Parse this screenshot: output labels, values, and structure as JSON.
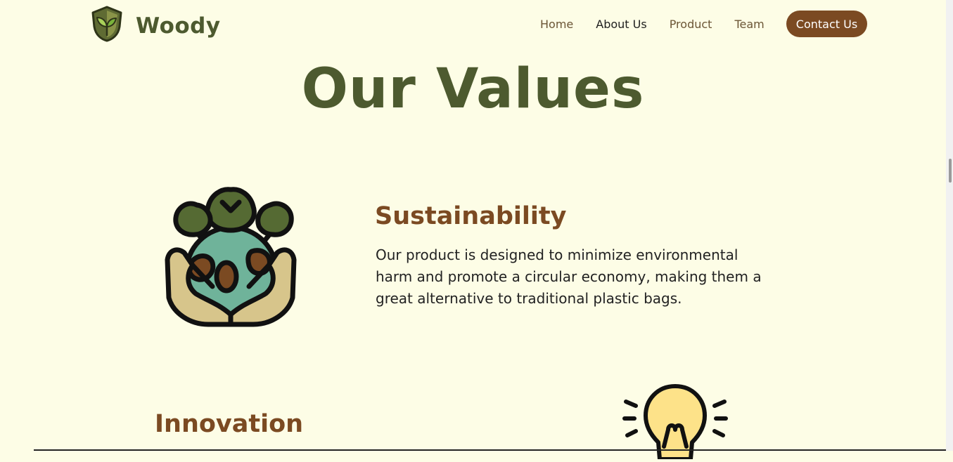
{
  "brand": {
    "name": "Woody"
  },
  "nav": {
    "items": [
      {
        "label": "Home"
      },
      {
        "label": "About Us"
      },
      {
        "label": "Product"
      },
      {
        "label": "Team"
      }
    ],
    "active": "About Us",
    "cta": "Contact Us"
  },
  "page": {
    "title": "Our Values"
  },
  "values": [
    {
      "title": "Sustainability",
      "description": "Our product is designed to minimize environmental harm and promote a circular economy, making them a great alternative to traditional plastic bags.",
      "icon": "earth-hands-trees-icon"
    },
    {
      "title": "Innovation",
      "icon": "lightbulb-icon"
    }
  ],
  "colors": {
    "background": "#fdfde6",
    "primary_green": "#4d5a2f",
    "accent_brown": "#7b4a22",
    "text_dark": "#222222"
  }
}
